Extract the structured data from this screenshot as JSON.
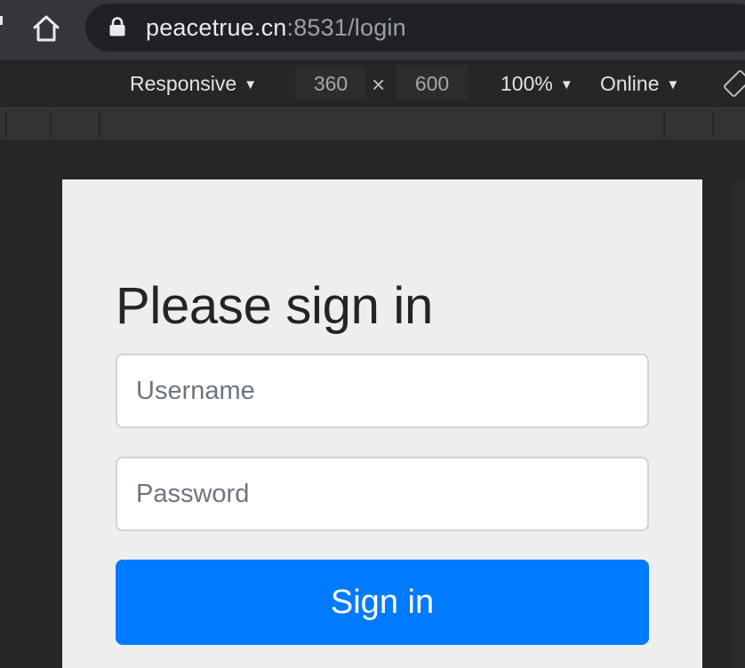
{
  "browser": {
    "url_host": "peacetrue.cn",
    "url_rest": ":8531/login"
  },
  "device_toolbar": {
    "device_mode": "Responsive",
    "width": "360",
    "height": "600",
    "zoom": "100%",
    "network": "Online"
  },
  "login": {
    "heading": "Please sign in",
    "username_placeholder": "Username",
    "password_placeholder": "Password",
    "submit_label": "Sign in"
  },
  "colors": {
    "primary": "#007bff",
    "page_background": "#eeeeee",
    "chrome_dark": "#35363a"
  },
  "icons": [
    "home-icon",
    "lock-icon",
    "caret-down-icon",
    "times-icon",
    "rotate-icon"
  ]
}
